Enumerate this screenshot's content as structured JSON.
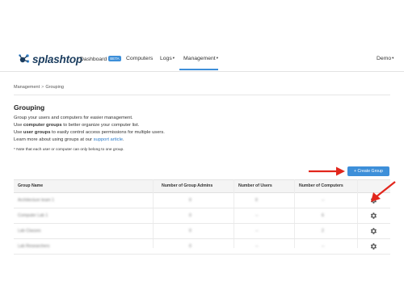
{
  "nav": {
    "brand": "splashtop",
    "items": [
      {
        "label": "Dashboard",
        "badge": "BETA"
      },
      {
        "label": "Computers"
      },
      {
        "label": "Logs",
        "caret": "▾"
      },
      {
        "label": "Management",
        "caret": "▾"
      }
    ],
    "user": {
      "label": "Demo",
      "caret": "▾"
    },
    "accent": "#3d8fd9"
  },
  "breadcrumb": {
    "parent": "Management",
    "separator": ">",
    "current": "Grouping"
  },
  "page": {
    "title": "Grouping",
    "intro": "Group your users and computers for easier management.",
    "computer_groups": {
      "prefix": "Use ",
      "bold": "computer groups",
      "suffix": " to better organize your computer list."
    },
    "user_groups": {
      "prefix": "Use ",
      "bold": "user groups",
      "suffix": " to easily control access permissions for multiple users."
    },
    "learn_more": {
      "prefix": "Learn more about using groups at our ",
      "link": "support article",
      "suffix": "."
    },
    "note": "* Note that each user or computer can only belong to one group."
  },
  "create_button": {
    "label": "+ Create Group"
  },
  "table": {
    "columns": [
      "Group Name",
      "Number of Group Admins",
      "Number of Users",
      "Number of Computers"
    ],
    "rows": [
      {
        "name": "Architecture team 1",
        "admins": "0",
        "users": "0",
        "computers": "--"
      },
      {
        "name": "Computer Lab 1",
        "admins": "0",
        "users": "--",
        "computers": "6"
      },
      {
        "name": "Lab Classes",
        "admins": "0",
        "users": "--",
        "computers": "2"
      },
      {
        "name": "Lab Researchers",
        "admins": "0",
        "users": "--",
        "computers": "--"
      }
    ]
  },
  "icons": {
    "gear": "gear-icon",
    "arrow": "red-arrow",
    "logo": "splashtop-logo-icon"
  },
  "colors": {
    "arrow": "#e2261c",
    "link": "#2a7ac9",
    "button": "#3d8fd9"
  }
}
